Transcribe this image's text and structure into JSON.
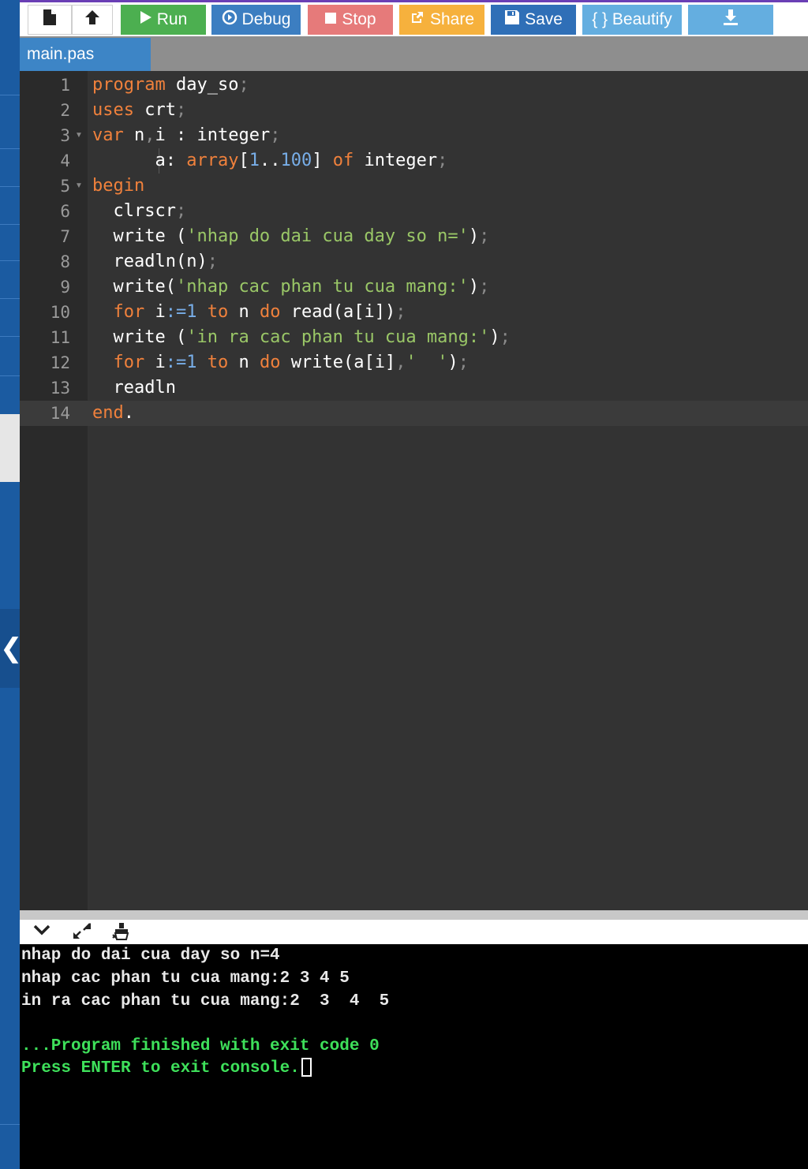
{
  "toolbar": {
    "run_label": "Run",
    "debug_label": "Debug",
    "stop_label": "Stop",
    "share_label": "Share",
    "save_label": "Save",
    "beautify_label": "{ } Beautify"
  },
  "icons": {
    "new": "new-file-icon",
    "upload": "upload-icon",
    "run": "play-icon",
    "debug": "debug-icon",
    "stop": "stop-icon",
    "share": "share-icon",
    "save": "floppy-icon",
    "download": "download-icon",
    "collapse": "chevron-down-icon",
    "expand": "expand-icon",
    "clear": "clear-console-icon",
    "sidebar_toggle": "chevron-left-icon"
  },
  "tab": {
    "label": "main.pas"
  },
  "editor": {
    "line_numbers": [
      "1",
      "2",
      "3",
      "4",
      "5",
      "6",
      "7",
      "8",
      "9",
      "10",
      "11",
      "12",
      "13",
      "14"
    ]
  },
  "console": {
    "lines": [
      "nhap do dai cua day so n=4",
      "nhap cac phan tu cua mang:2 3 4 5",
      "in ra cac phan tu cua mang:2  3  4  5",
      "",
      "...Program finished with exit code 0",
      "Press ENTER to exit console."
    ]
  },
  "colors": {
    "keyword": "#f0813c",
    "string": "#9ac767",
    "number": "#78aee8",
    "run": "#4caf50",
    "debug": "#3c7ec1",
    "stop": "#e67a7a",
    "share": "#f6b13d",
    "save": "#2f6fb7",
    "beautify": "#64aee0"
  }
}
